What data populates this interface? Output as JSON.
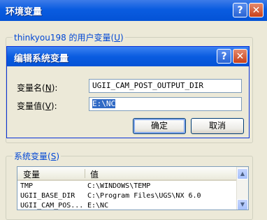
{
  "outer_window": {
    "title": "环境变量",
    "help_glyph": "?",
    "close_glyph": "✕"
  },
  "user_vars": {
    "group_label": "thinkyou198 的用户变量",
    "mnemonic": "U"
  },
  "edit_dialog": {
    "title": "编辑系统变量",
    "help_glyph": "?",
    "close_glyph": "✕",
    "name_label": "变量名",
    "name_mnemonic": "N",
    "name_value": "UGII_CAM_POST_OUTPUT_DIR",
    "value_label": "变量值",
    "value_mnemonic": "V",
    "value_value": "E:\\NC",
    "ok_label": "确定",
    "cancel_label": "取消"
  },
  "system_vars": {
    "group_label": "系统变量",
    "mnemonic": "S",
    "columns": [
      "变量",
      "值"
    ],
    "rows": [
      {
        "name": "TMP",
        "value": "C:\\WINDOWS\\TEMP"
      },
      {
        "name": "UGII_BASE_DIR",
        "value": "C:\\Program Files\\UGS\\NX 6.0"
      },
      {
        "name": "UGII_CAM_POS...",
        "value": "E:\\NC"
      }
    ]
  }
}
